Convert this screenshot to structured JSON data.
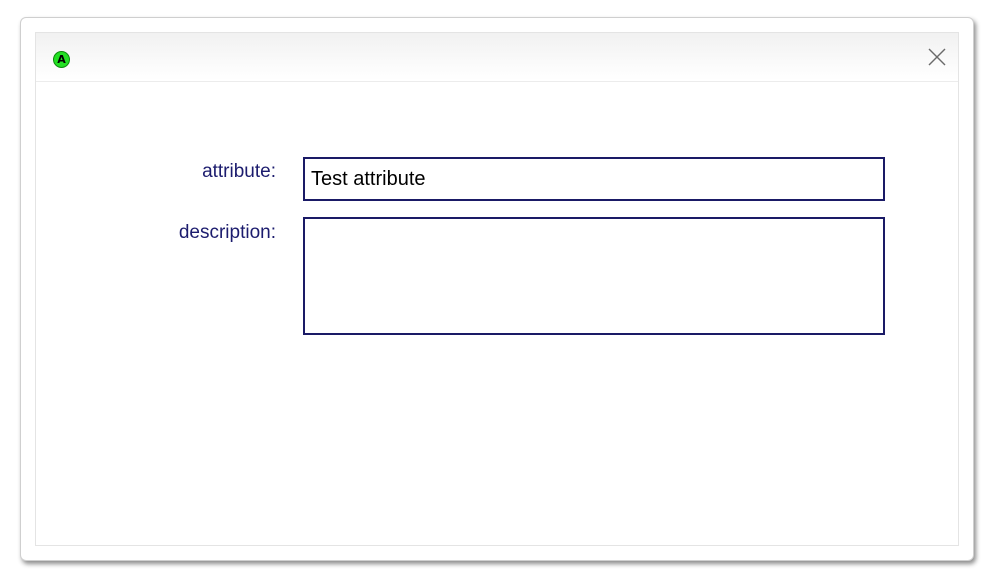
{
  "dialog": {
    "app_icon_letter": "A",
    "icons": {
      "app": "app-logo-icon",
      "close": "close-icon"
    }
  },
  "form": {
    "attribute": {
      "label": "attribute:",
      "value": "Test attribute"
    },
    "description": {
      "label": "description:",
      "value": ""
    }
  },
  "colors": {
    "label_text": "#1c1c6e",
    "field_border": "#1a1a66",
    "app_icon": "#22e022"
  }
}
